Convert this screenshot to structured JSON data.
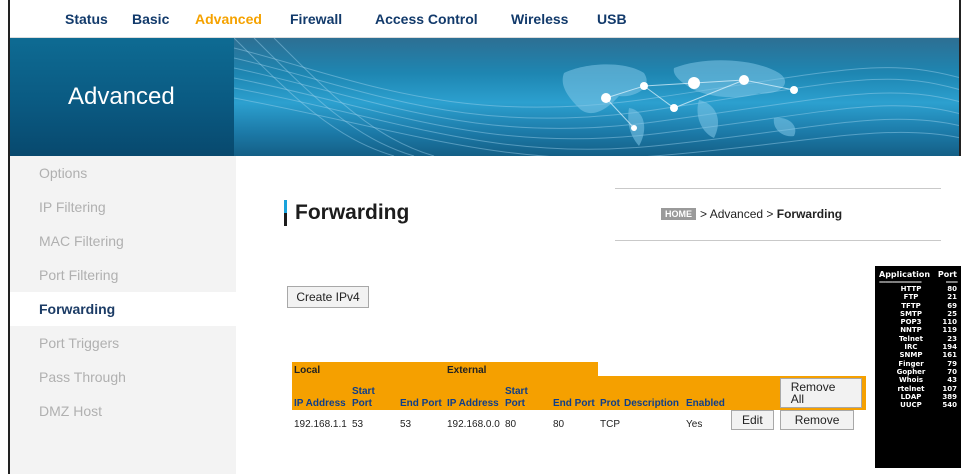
{
  "nav": [
    "Status",
    "Basic",
    "Advanced",
    "Firewall",
    "Access Control",
    "Wireless",
    "USB"
  ],
  "nav_active": "Advanced",
  "banner_title": "Advanced",
  "sidebar": [
    "Options",
    "IP Filtering",
    "MAC Filtering",
    "Port Filtering",
    "Forwarding",
    "Port Triggers",
    "Pass Through",
    "DMZ Host"
  ],
  "sidebar_active": "Forwarding",
  "page_title": "Forwarding",
  "breadcrumb": {
    "home": "HOME",
    "sep": ">",
    "parent": "Advanced",
    "current": "Forwarding"
  },
  "create_button": "Create IPv4",
  "table": {
    "group_local": "Local",
    "group_external": "External",
    "headers": [
      "IP Address",
      "Start Port",
      "End Port",
      "IP Address",
      "Start Port",
      "End Port",
      "Prot",
      "Description",
      "Enabled"
    ],
    "remove_all": "Remove All",
    "rows": [
      {
        "local_ip": "192.168.1.1",
        "local_start": "53",
        "local_end": "53",
        "ext_ip": "192.168.0.0",
        "ext_start": "80",
        "ext_end": "80",
        "prot": "TCP",
        "description": "",
        "enabled": "Yes",
        "edit": "Edit",
        "remove": "Remove"
      }
    ]
  },
  "port_reference": {
    "col_app": "Application",
    "col_port": "Port",
    "entries": [
      [
        "HTTP",
        "80"
      ],
      [
        "FTP",
        "21"
      ],
      [
        "TFTP",
        "69"
      ],
      [
        "SMTP",
        "25"
      ],
      [
        "POP3",
        "110"
      ],
      [
        "NNTP",
        "119"
      ],
      [
        "Telnet",
        "23"
      ],
      [
        "IRC",
        "194"
      ],
      [
        "SNMP",
        "161"
      ],
      [
        "Finger",
        "79"
      ],
      [
        "Gopher",
        "70"
      ],
      [
        "Whois",
        "43"
      ],
      [
        "rtelnet",
        "107"
      ],
      [
        "LDAP",
        "389"
      ],
      [
        "UUCP",
        "540"
      ]
    ]
  },
  "colors": {
    "nav_text": "#123a6b",
    "nav_active": "#f5a200",
    "table_header": "#f5a000",
    "banner": "#0e6a94"
  }
}
